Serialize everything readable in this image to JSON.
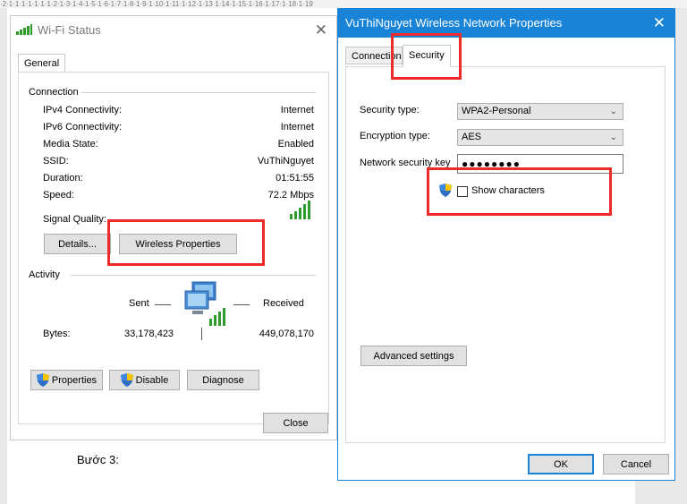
{
  "ruler_text": "·2·1·1·1·1·1·1·1·2·1·3·1·4·1·5·1·6·1·7·1·8·1·9·1·10·1·11·1·12·1·13·1·14·1·15·1·16·1·17·1·18·1·19",
  "document": {
    "step_text": "Bước 3:"
  },
  "wifi_status": {
    "title": "Wi-Fi Status",
    "tab": "General",
    "connection": {
      "header": "Connection",
      "rows": [
        {
          "label": "IPv4 Connectivity:",
          "value": "Internet"
        },
        {
          "label": "IPv6 Connectivity:",
          "value": "Internet"
        },
        {
          "label": "Media State:",
          "value": "Enabled"
        },
        {
          "label": "SSID:",
          "value": "VuThiNguyet"
        },
        {
          "label": "Duration:",
          "value": "01:51:55"
        },
        {
          "label": "Speed:",
          "value": "72.2 Mbps"
        }
      ],
      "signal_label": "Signal Quality:"
    },
    "details_button": "Details...",
    "wireless_properties_button": "Wireless Properties",
    "activity": {
      "header": "Activity",
      "sent_label": "Sent",
      "received_label": "Received",
      "bytes_label": "Bytes:",
      "bytes_sent": "33,178,423",
      "bytes_received": "449,078,170"
    },
    "properties_button": "Properties",
    "disable_button": "Disable",
    "diagnose_button": "Diagnose",
    "close_button": "Close"
  },
  "network_properties": {
    "title": "VuThiNguyet Wireless Network Properties",
    "tabs": [
      "Connection",
      "Security"
    ],
    "security_type_label": "Security type:",
    "security_type_value": "WPA2-Personal",
    "encryption_type_label": "Encryption type:",
    "encryption_type_value": "AES",
    "key_label": "Network security key",
    "key_value": "●●●●●●●●",
    "show_characters_label": "Show characters",
    "advanced_button": "Advanced settings",
    "ok_button": "OK",
    "cancel_button": "Cancel"
  },
  "colors": {
    "title_blue": "#1883d7",
    "highlight_red": "#ee2b2b",
    "signal_green": "#2e9b2e"
  }
}
